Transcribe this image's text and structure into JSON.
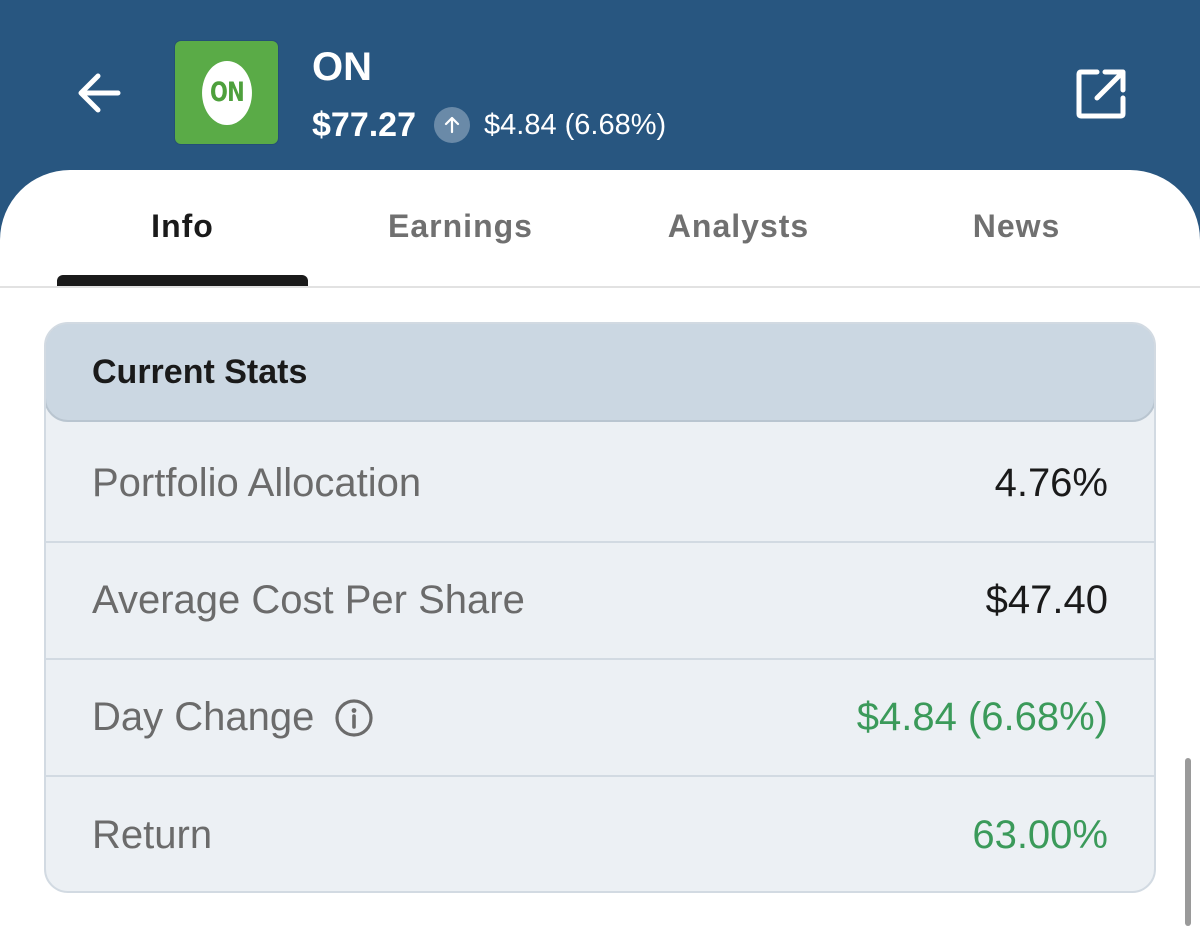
{
  "header": {
    "ticker": "ON",
    "logo_text": "ON",
    "price": "$77.27",
    "change": "$4.84 (6.68%)",
    "change_direction": "up",
    "background_color": "#285680",
    "logo_color": "#5aab47"
  },
  "tabs": [
    {
      "label": "Info",
      "active": true
    },
    {
      "label": "Earnings",
      "active": false
    },
    {
      "label": "Analysts",
      "active": false
    },
    {
      "label": "News",
      "active": false
    }
  ],
  "current_stats": {
    "title": "Current Stats",
    "rows": [
      {
        "label": "Portfolio Allocation",
        "value": "4.76%"
      },
      {
        "label": "Average Cost Per Share",
        "value": "$47.40"
      },
      {
        "label": "Day Change",
        "value": "$4.84 (6.68%)",
        "has_info_icon": true,
        "positive": true
      },
      {
        "label": "Return",
        "value": "63.00%",
        "positive": true
      }
    ]
  },
  "colors": {
    "positive": "#3b9a5a",
    "card_bg": "#ecf0f4",
    "card_header_bg": "#cbd7e2"
  },
  "icons": {
    "back": "arrow-left-icon",
    "external": "open-external-icon",
    "change_arrow": "arrow-up-icon",
    "info": "info-icon"
  }
}
